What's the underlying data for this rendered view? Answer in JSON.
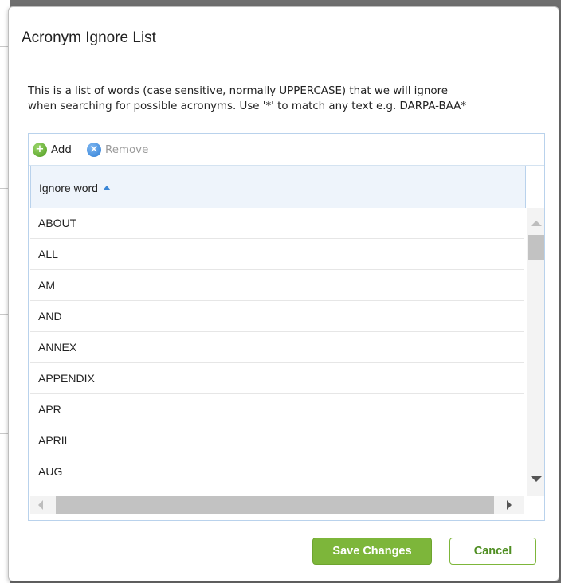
{
  "dialog": {
    "title": "Acronym Ignore List",
    "description_line1": "This is a list of words (case sensitive, normally UPPERCASE) that we will ignore",
    "description_line2": "when searching for possible acronyms. Use '*' to match any text e.g. DARPA-BAA*"
  },
  "toolbar": {
    "add_label": "Add",
    "remove_label": "Remove",
    "add_icon": "plus-circle-icon",
    "remove_icon": "x-circle-icon"
  },
  "grid": {
    "column_header": "Ignore word",
    "sort": "ascending",
    "rows": [
      "ABOUT",
      "ALL",
      "AM",
      "AND",
      "ANNEX",
      "APPENDIX",
      "APR",
      "APRIL",
      "AUG"
    ]
  },
  "footer": {
    "save_label": "Save Changes",
    "cancel_label": "Cancel"
  },
  "colors": {
    "accent_green": "#7db63a",
    "accent_blue": "#3b86d6",
    "grid_border": "#b9d2ec"
  }
}
